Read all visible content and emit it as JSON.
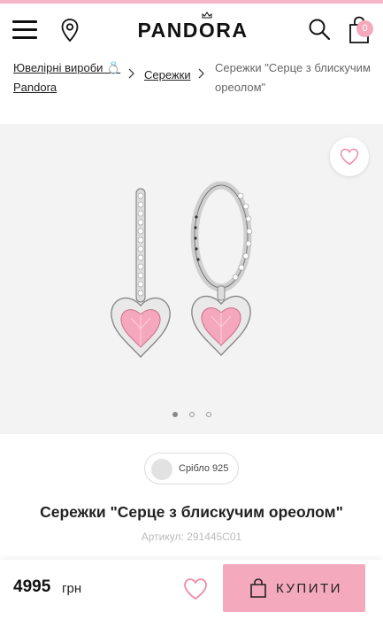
{
  "header": {
    "logo": "PANDORA",
    "cart_count": "0",
    "icons": [
      "menu-icon",
      "location-pin-icon",
      "search-icon",
      "shopping-bag-icon"
    ]
  },
  "breadcrumb": {
    "level1": "Ювелірні вироби 💍 Pandora",
    "level2": "Сережки",
    "current": "Сережки \"Серце з блискучим ореолом\""
  },
  "gallery": {
    "image_count": 3,
    "active_index": 0
  },
  "product": {
    "metal_option": "Срібло 925",
    "title": "Сережки \"Серце з блискучим ореолом\"",
    "sku": "Артикул: 291445C01"
  },
  "purchase": {
    "price": "4995",
    "currency": "грн",
    "buy_label": "КУПИТИ"
  },
  "colors": {
    "accent_pink": "#f4a9bd",
    "top_stripe": "#f4b6c6",
    "gallery_bg": "#f3f3f3"
  }
}
